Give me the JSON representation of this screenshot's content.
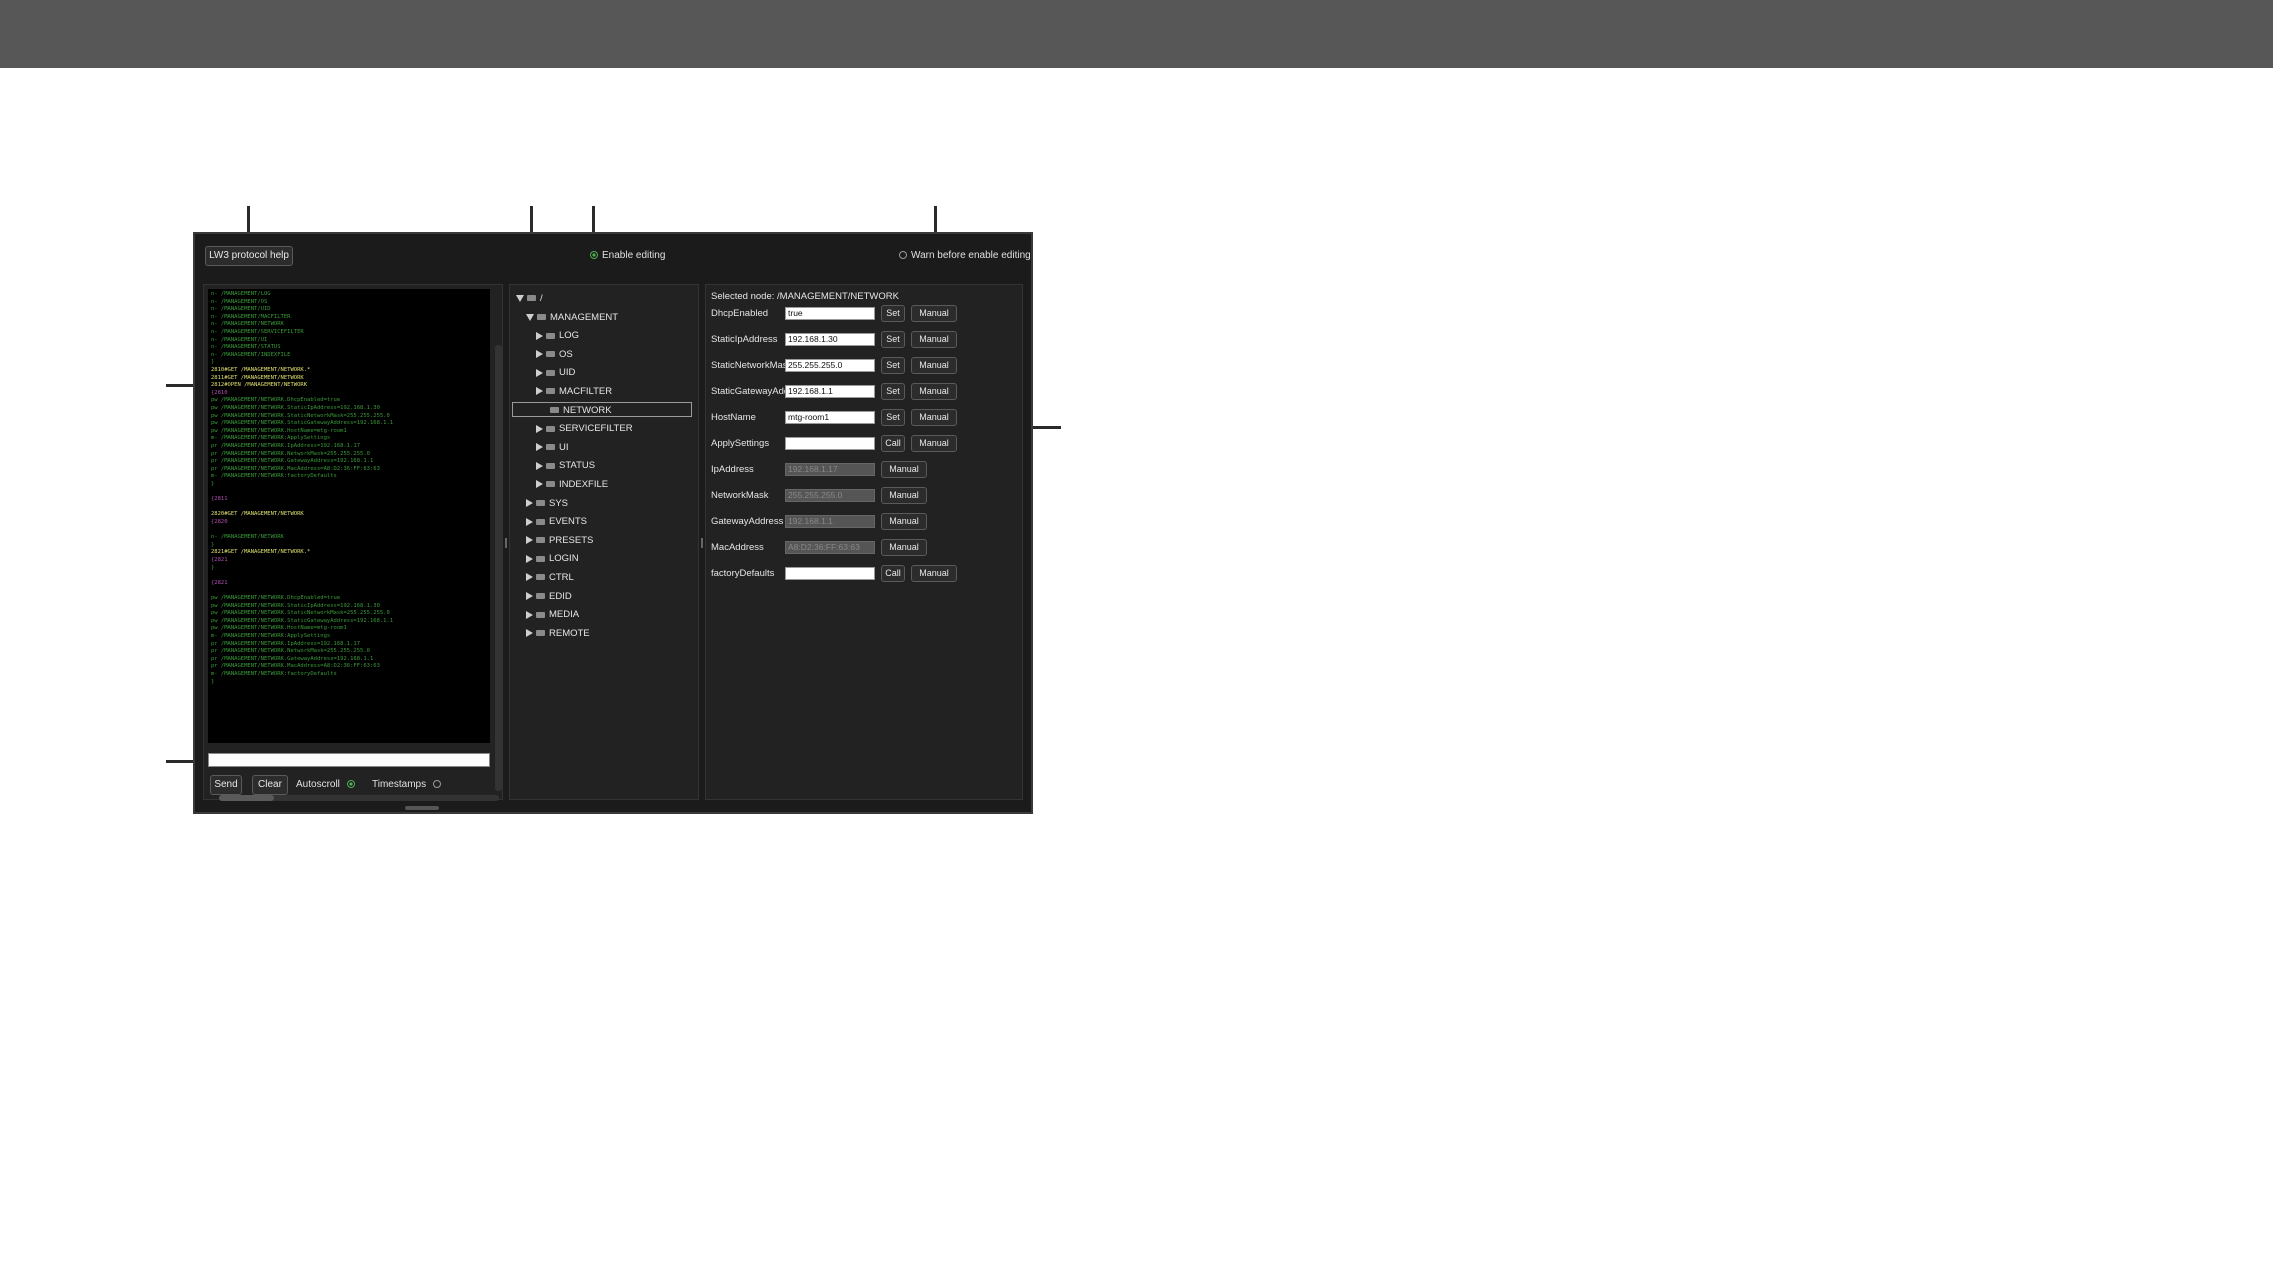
{
  "window": {
    "toolbar": {
      "protocol_help_label": "LW3 protocol help",
      "enable_editing_label": "Enable editing",
      "warn_label": "Warn before enable editing"
    },
    "console": {
      "lines": [
        {
          "t": "n- /MANAGEMENT/LOG",
          "c": "g"
        },
        {
          "t": "n- /MANAGEMENT/OS",
          "c": "g"
        },
        {
          "t": "n- /MANAGEMENT/UID",
          "c": "g"
        },
        {
          "t": "n- /MANAGEMENT/MACFILTER",
          "c": "g"
        },
        {
          "t": "n- /MANAGEMENT/NETWORK",
          "c": "g"
        },
        {
          "t": "n- /MANAGEMENT/SERVICEFILTER",
          "c": "g"
        },
        {
          "t": "n- /MANAGEMENT/UI",
          "c": "g"
        },
        {
          "t": "n- /MANAGEMENT/STATUS",
          "c": "g"
        },
        {
          "t": "n- /MANAGEMENT/INDEXFILE",
          "c": "g"
        },
        {
          "t": "}",
          "c": "g"
        },
        {
          "t": "2810#GET /MANAGEMENT/NETWORK.*",
          "c": "y"
        },
        {
          "t": "2811#GET /MANAGEMENT/NETWORK",
          "c": "y"
        },
        {
          "t": "2812#OPEN /MANAGEMENT/NETWORK",
          "c": "y"
        },
        {
          "t": "{2810",
          "c": "m"
        },
        {
          "t": "pw /MANAGEMENT/NETWORK.DhcpEnabled=true",
          "c": "g"
        },
        {
          "t": "pw /MANAGEMENT/NETWORK.StaticIpAddress=192.168.1.30",
          "c": "g"
        },
        {
          "t": "pw /MANAGEMENT/NETWORK.StaticNetworkMask=255.255.255.0",
          "c": "g"
        },
        {
          "t": "pw /MANAGEMENT/NETWORK.StaticGatewayAddress=192.168.1.1",
          "c": "g"
        },
        {
          "t": "pw /MANAGEMENT/NETWORK.HostName=mtg-room1",
          "c": "g"
        },
        {
          "t": "m- /MANAGEMENT/NETWORK:ApplySettings",
          "c": "g"
        },
        {
          "t": "pr /MANAGEMENT/NETWORK.IpAddress=192.168.1.17",
          "c": "g"
        },
        {
          "t": "pr /MANAGEMENT/NETWORK.NetworkMask=255.255.255.0",
          "c": "g"
        },
        {
          "t": "pr /MANAGEMENT/NETWORK.GatewayAddress=192.168.1.1",
          "c": "g"
        },
        {
          "t": "pr /MANAGEMENT/NETWORK.MacAddress=A8:D2:36:FF:63:63",
          "c": "g"
        },
        {
          "t": "m- /MANAGEMENT/NETWORK:factoryDefaults",
          "c": "g"
        },
        {
          "t": "}",
          "c": "g"
        },
        {
          "t": "",
          "c": "g"
        },
        {
          "t": "{2811",
          "c": "m"
        },
        {
          "t": "",
          "c": "g"
        },
        {
          "t": "2820#GET /MANAGEMENT/NETWORK",
          "c": "y"
        },
        {
          "t": "{2820",
          "c": "m"
        },
        {
          "t": "",
          "c": "g"
        },
        {
          "t": "n- /MANAGEMENT/NETWORK",
          "c": "g"
        },
        {
          "t": "}",
          "c": "g"
        },
        {
          "t": "2821#GET /MANAGEMENT/NETWORK.*",
          "c": "y"
        },
        {
          "t": "{2821",
          "c": "m"
        },
        {
          "t": "}",
          "c": "g"
        },
        {
          "t": "",
          "c": "g"
        },
        {
          "t": "{2821",
          "c": "m"
        },
        {
          "t": "",
          "c": "g"
        },
        {
          "t": "pw /MANAGEMENT/NETWORK.DhcpEnabled=true",
          "c": "g"
        },
        {
          "t": "pw /MANAGEMENT/NETWORK.StaticIpAddress=192.168.1.30",
          "c": "g"
        },
        {
          "t": "pw /MANAGEMENT/NETWORK.StaticNetworkMask=255.255.255.0",
          "c": "g"
        },
        {
          "t": "pw /MANAGEMENT/NETWORK.StaticGatewayAddress=192.168.1.1",
          "c": "g"
        },
        {
          "t": "pw /MANAGEMENT/NETWORK.HostName=mtg-room1",
          "c": "g"
        },
        {
          "t": "m- /MANAGEMENT/NETWORK:ApplySettings",
          "c": "g"
        },
        {
          "t": "pr /MANAGEMENT/NETWORK.IpAddress=192.168.1.17",
          "c": "g"
        },
        {
          "t": "pr /MANAGEMENT/NETWORK.NetworkMask=255.255.255.0",
          "c": "g"
        },
        {
          "t": "pr /MANAGEMENT/NETWORK.GatewayAddress=192.168.1.1",
          "c": "g"
        },
        {
          "t": "pr /MANAGEMENT/NETWORK.MacAddress=A8:D2:36:FF:63:63",
          "c": "g"
        },
        {
          "t": "m- /MANAGEMENT/NETWORK:factoryDefaults",
          "c": "g"
        },
        {
          "t": "}",
          "c": "g"
        }
      ],
      "send_label": "Send",
      "clear_label": "Clear",
      "autoscroll_label": "Autoscroll",
      "timestamps_label": "Timestamps"
    },
    "tree": {
      "items": [
        {
          "label": "/",
          "depth": 0,
          "arrow": "down"
        },
        {
          "label": "MANAGEMENT",
          "depth": 1,
          "arrow": "down"
        },
        {
          "label": "LOG",
          "depth": 2,
          "arrow": "right"
        },
        {
          "label": "OS",
          "depth": 2,
          "arrow": "right"
        },
        {
          "label": "UID",
          "depth": 2,
          "arrow": "right"
        },
        {
          "label": "MACFILTER",
          "depth": 2,
          "arrow": "right"
        },
        {
          "label": "NETWORK",
          "depth": 2,
          "arrow": "none",
          "selected": true
        },
        {
          "label": "SERVICEFILTER",
          "depth": 2,
          "arrow": "right"
        },
        {
          "label": "UI",
          "depth": 2,
          "arrow": "right"
        },
        {
          "label": "STATUS",
          "depth": 2,
          "arrow": "right"
        },
        {
          "label": "INDEXFILE",
          "depth": 2,
          "arrow": "right"
        },
        {
          "label": "SYS",
          "depth": 1,
          "arrow": "right"
        },
        {
          "label": "EVENTS",
          "depth": 1,
          "arrow": "right"
        },
        {
          "label": "PRESETS",
          "depth": 1,
          "arrow": "right"
        },
        {
          "label": "LOGIN",
          "depth": 1,
          "arrow": "right"
        },
        {
          "label": "CTRL",
          "depth": 1,
          "arrow": "right"
        },
        {
          "label": "EDID",
          "depth": 1,
          "arrow": "right"
        },
        {
          "label": "MEDIA",
          "depth": 1,
          "arrow": "right"
        },
        {
          "label": "REMOTE",
          "depth": 1,
          "arrow": "right"
        }
      ]
    },
    "properties": {
      "selected_node": "Selected node: /MANAGEMENT/NETWORK",
      "rows": [
        {
          "name": "DhcpEnabled",
          "value": "true",
          "editable": true,
          "action": "Set",
          "manual": "Manual"
        },
        {
          "name": "StaticIpAddress",
          "value": "192.168.1.30",
          "editable": true,
          "action": "Set",
          "manual": "Manual"
        },
        {
          "name": "StaticNetworkMask",
          "value": "255.255.255.0",
          "editable": true,
          "action": "Set",
          "manual": "Manual"
        },
        {
          "name": "StaticGatewayAddress",
          "value": "192.168.1.1",
          "editable": true,
          "action": "Set",
          "manual": "Manual"
        },
        {
          "name": "HostName",
          "value": "mtg-room1",
          "editable": true,
          "action": "Set",
          "manual": "Manual"
        },
        {
          "name": "ApplySettings",
          "value": "",
          "editable": true,
          "action": "Call",
          "manual": "Manual"
        },
        {
          "name": "IpAddress",
          "value": "192.168.1.17",
          "editable": false,
          "action": "",
          "manual": "Manual"
        },
        {
          "name": "NetworkMask",
          "value": "255.255.255.0",
          "editable": false,
          "action": "",
          "manual": "Manual"
        },
        {
          "name": "GatewayAddress",
          "value": "192.168.1.1",
          "editable": false,
          "action": "",
          "manual": "Manual"
        },
        {
          "name": "MacAddress",
          "value": "A8:D2:36:FF:63:63",
          "editable": false,
          "action": "",
          "manual": "Manual"
        },
        {
          "name": "factoryDefaults",
          "value": "",
          "editable": true,
          "action": "Call",
          "manual": "Manual"
        }
      ]
    }
  }
}
